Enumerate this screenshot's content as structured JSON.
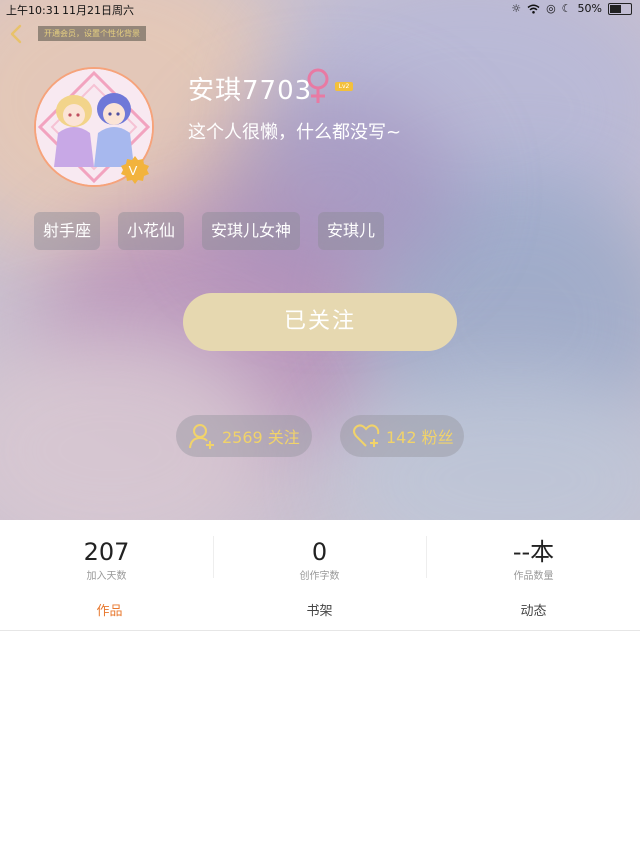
{
  "status_bar": {
    "time": "上午10:31",
    "date": "11月21日周六",
    "battery": "50%",
    "battery_level": 0.5
  },
  "header": {
    "vip_banner": "开通会员，设置个性化背景"
  },
  "profile": {
    "username": "安琪7703",
    "level": "Lv2",
    "bio": "这个人很懒，什么都没写~",
    "vip_badge": "V",
    "tags": [
      "射手座",
      "小花仙",
      "安琪儿女神",
      "安琪儿"
    ],
    "follow_button": "已关注",
    "following": "2569 关注",
    "fans": "142 粉丝"
  },
  "stats": [
    {
      "value": "207",
      "label": "加入天数"
    },
    {
      "value": "0",
      "label": "创作字数"
    },
    {
      "value": "--本",
      "label": "作品数量"
    }
  ],
  "tabs": [
    {
      "label": "作品",
      "active": true
    },
    {
      "label": "书架",
      "active": false
    },
    {
      "label": "动态",
      "active": false
    }
  ],
  "colors": {
    "accent": "#e8782e",
    "gold": "#f1d36a",
    "follow_button": "#e6d8b0",
    "gender_female": "#e87aa3"
  }
}
